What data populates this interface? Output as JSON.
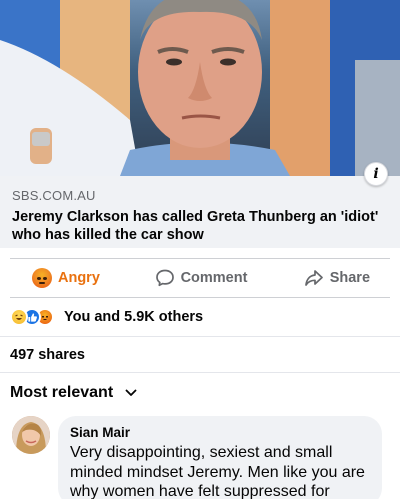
{
  "post": {
    "link": {
      "domain": "SBS.COM.AU",
      "title": "Jeremy Clarkson has called Greta Thunberg an 'idiot' who has killed the car show"
    },
    "info_icon": "info-icon"
  },
  "actions": {
    "react_label": "Angry",
    "comment_label": "Comment",
    "share_label": "Share"
  },
  "reactions": {
    "icons": [
      "haha",
      "like",
      "angry"
    ],
    "summary": "You and 5.9K others"
  },
  "shares": "497 shares",
  "comments_sort": {
    "label": "Most relevant"
  },
  "comment": {
    "author": "Sian Mair",
    "text": "Very disappointing, sexiest and small minded mindset Jeremy. Men like you are why women have felt suppressed for years."
  },
  "colors": {
    "angry_accent": "#e9710f",
    "muted_text": "#65676b",
    "link_bg": "#f0f2f5",
    "like_blue": "#1b74e4"
  }
}
